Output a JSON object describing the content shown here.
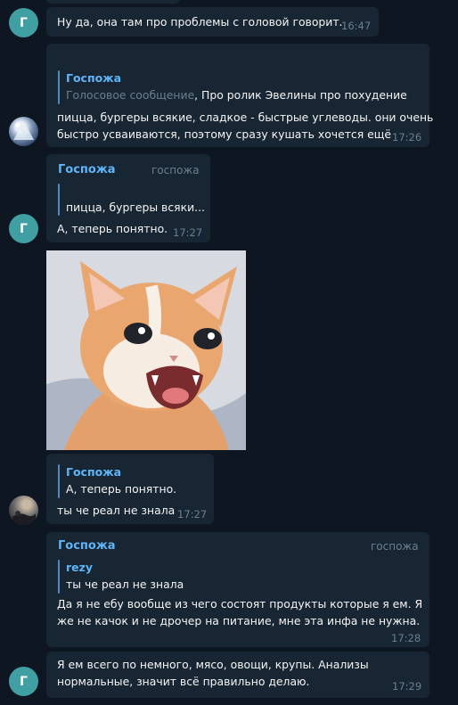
{
  "messages": {
    "m1": {
      "avatar_letter": "Г",
      "text": "Ну да, она там про проблемы с головой говорит.",
      "time": "16:47"
    },
    "m2": {
      "quote_author": "Госпожа",
      "quote_kind": "Голосовое сообщение",
      "quote_text": ", Про ролик Эвелины про похудение",
      "text_line1": "пицца, бургеры всякие, сладкое - быстрые углеводы. они очень",
      "text_line2": "быстро усваиваются, поэтому сразу кушать хочется ещё",
      "time": "17:26"
    },
    "m3": {
      "avatar_letter": "Г",
      "author": "Госпожа",
      "role": "госпожа",
      "quote_text": "пицца, бургеры всяки...",
      "text": "А, теперь понятно.",
      "time": "17:27"
    },
    "m4": {
      "quote_author": "Госпожа",
      "quote_text": "А, теперь понятно.",
      "text": "ты че реал не знала",
      "time": "17:27"
    },
    "m5": {
      "author": "Госпожа",
      "role": "госпожа",
      "quote_author": "rezy",
      "quote_text": "ты че реал не знала",
      "text_line1": "Да я не ебу вообще из чего состоят продукты которые я ем. Я",
      "text_line2": "же не качок и не дрочер на питание, мне эта инфа не нужна.",
      "time": "17:28"
    },
    "m6": {
      "avatar_letter": "Г",
      "text_line1": "Я ем всего по немного, мясо, овощи, крупы. Анализы",
      "text_line2": "нормальные, значит всё правильно делаю.",
      "time": "17:29"
    }
  },
  "colors": {
    "background": "#0e1621",
    "bubble": "#182533",
    "accent": "#5eb5f7",
    "avatar": "#3f9fa3",
    "meta": "#6d7f8f"
  }
}
